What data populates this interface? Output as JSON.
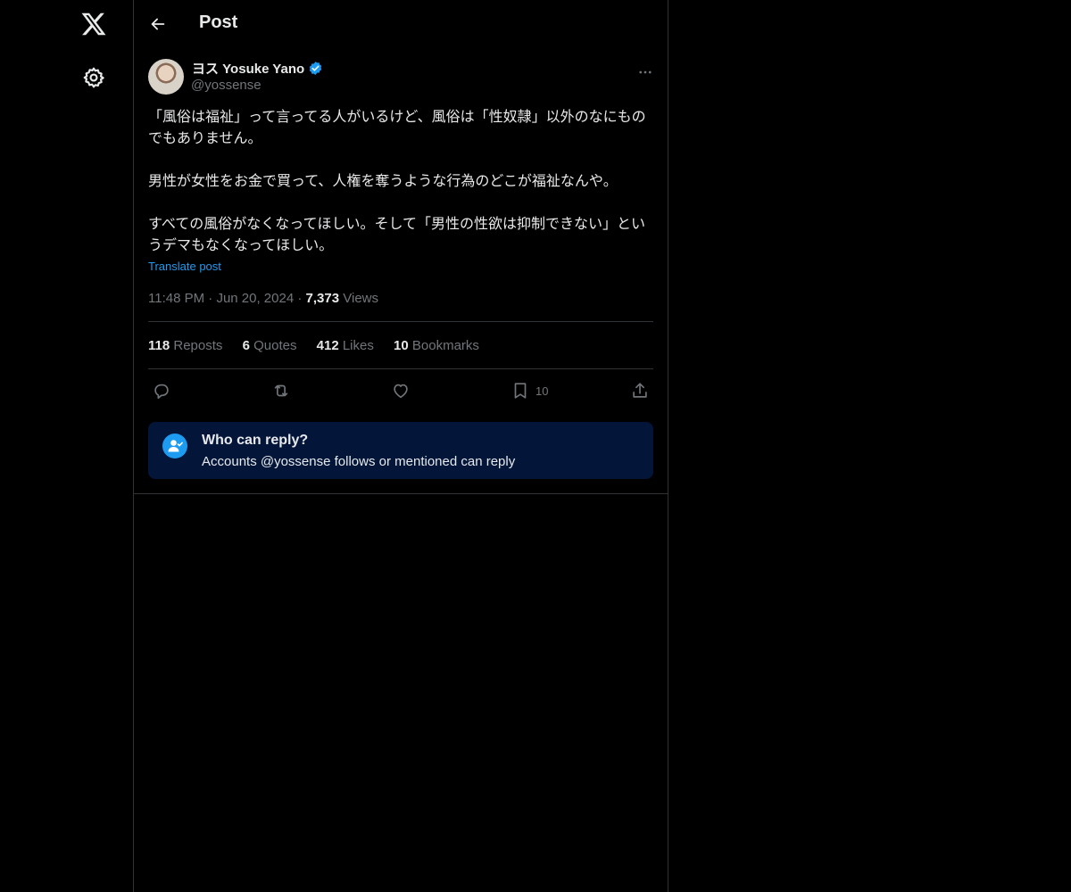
{
  "header": {
    "title": "Post"
  },
  "author": {
    "name": "ヨス Yosuke Yano",
    "handle": "@yossense"
  },
  "post": {
    "lines": [
      "「風俗は福祉」って言ってる人がいるけど、風俗は「性奴隷」以外のなにものでもありません。",
      "男性が女性をお金で買って、人権を奪うような行為のどこが福祉なんや。",
      "すべての風俗がなくなってほしい。そして「男性の性欲は抑制できない」というデマもなくなってほしい。"
    ],
    "translate_label": "Translate post",
    "time": "11:48 PM",
    "date": "Jun 20, 2024",
    "views_count": "7,373",
    "views_label": "Views"
  },
  "stats": {
    "reposts": {
      "count": "118",
      "label": "Reposts"
    },
    "quotes": {
      "count": "6",
      "label": "Quotes"
    },
    "likes": {
      "count": "412",
      "label": "Likes"
    },
    "bookmarks": {
      "count": "10",
      "label": "Bookmarks"
    }
  },
  "actions": {
    "bookmark_count": "10"
  },
  "reply_notice": {
    "title": "Who can reply?",
    "text": "Accounts @yossense follows or mentioned can reply"
  },
  "icons": {
    "logo": "x-logo-icon",
    "settings": "gear-icon",
    "back": "arrow-left-icon",
    "more": "more-horizontal-icon",
    "reply": "reply-icon",
    "repost": "repost-icon",
    "like": "heart-icon",
    "bookmark": "bookmark-icon",
    "share": "share-icon"
  },
  "colors": {
    "accent": "#1d9bf0",
    "notice_bg": "#031539",
    "muted": "#71767b"
  }
}
